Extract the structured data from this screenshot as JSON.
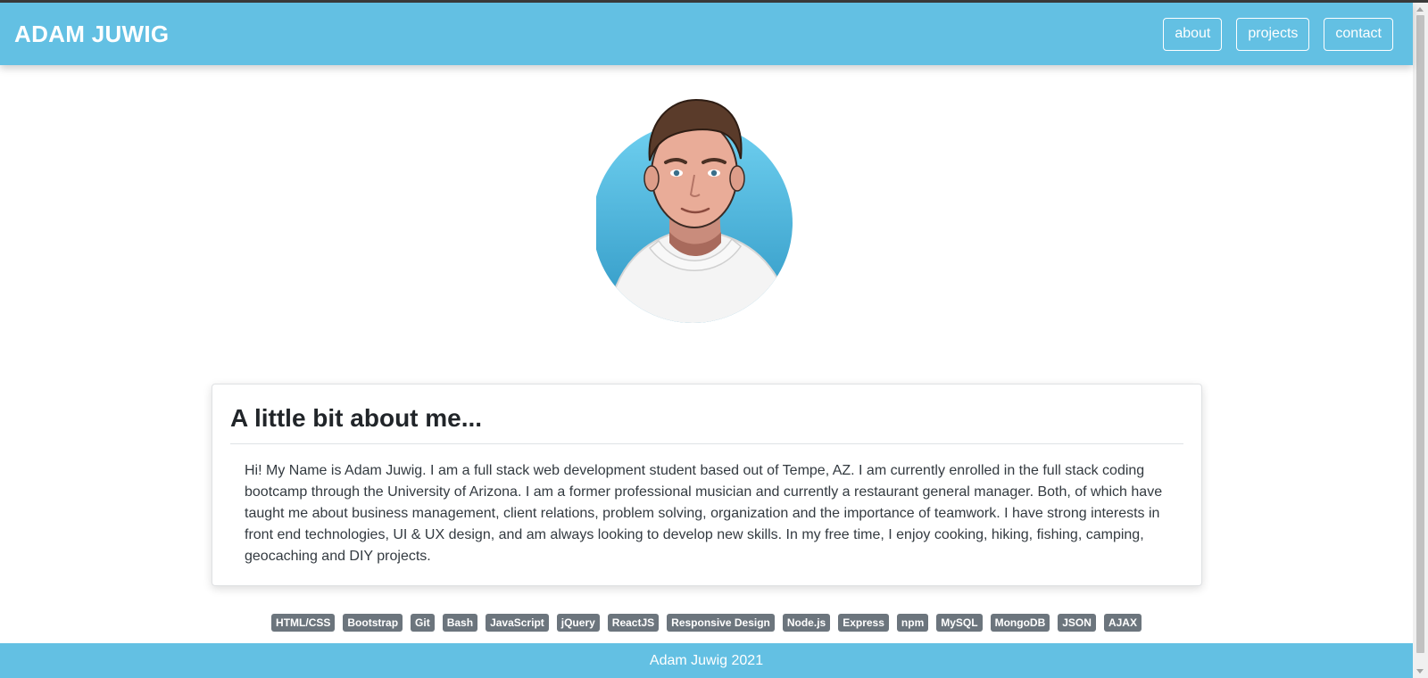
{
  "header": {
    "brand": "ADAM JUWIG",
    "nav": [
      {
        "label": "about"
      },
      {
        "label": "projects"
      },
      {
        "label": "contact"
      }
    ]
  },
  "about": {
    "title": "A little bit about me...",
    "body": "Hi! My Name is Adam Juwig. I am a full stack web development student based out of Tempe, AZ. I am currently enrolled in the full stack coding bootcamp through the University of Arizona. I am a former professional musician and currently a restaurant general manager. Both, of which have taught me about business management, client relations, problem solving, organization and the importance of teamwork. I have strong interests in front end technologies, UI & UX design, and am always looking to develop new skills. In my free time, I enjoy cooking, hiking, fishing, camping, geocaching and DIY projects."
  },
  "skills": [
    "HTML/CSS",
    "Bootstrap",
    "Git",
    "Bash",
    "JavaScript",
    "jQuery",
    "ReactJS",
    "Responsive Design",
    "Node.js",
    "Express",
    "npm",
    "MySQL",
    "MongoDB",
    "JSON",
    "AJAX"
  ],
  "footer": {
    "text": "Adam Juwig 2021"
  },
  "colors": {
    "accent": "#63c0e3",
    "badge": "#6c757d",
    "text": "#212529"
  },
  "icons": {
    "avatar": "cartoon-portrait-avatar"
  }
}
